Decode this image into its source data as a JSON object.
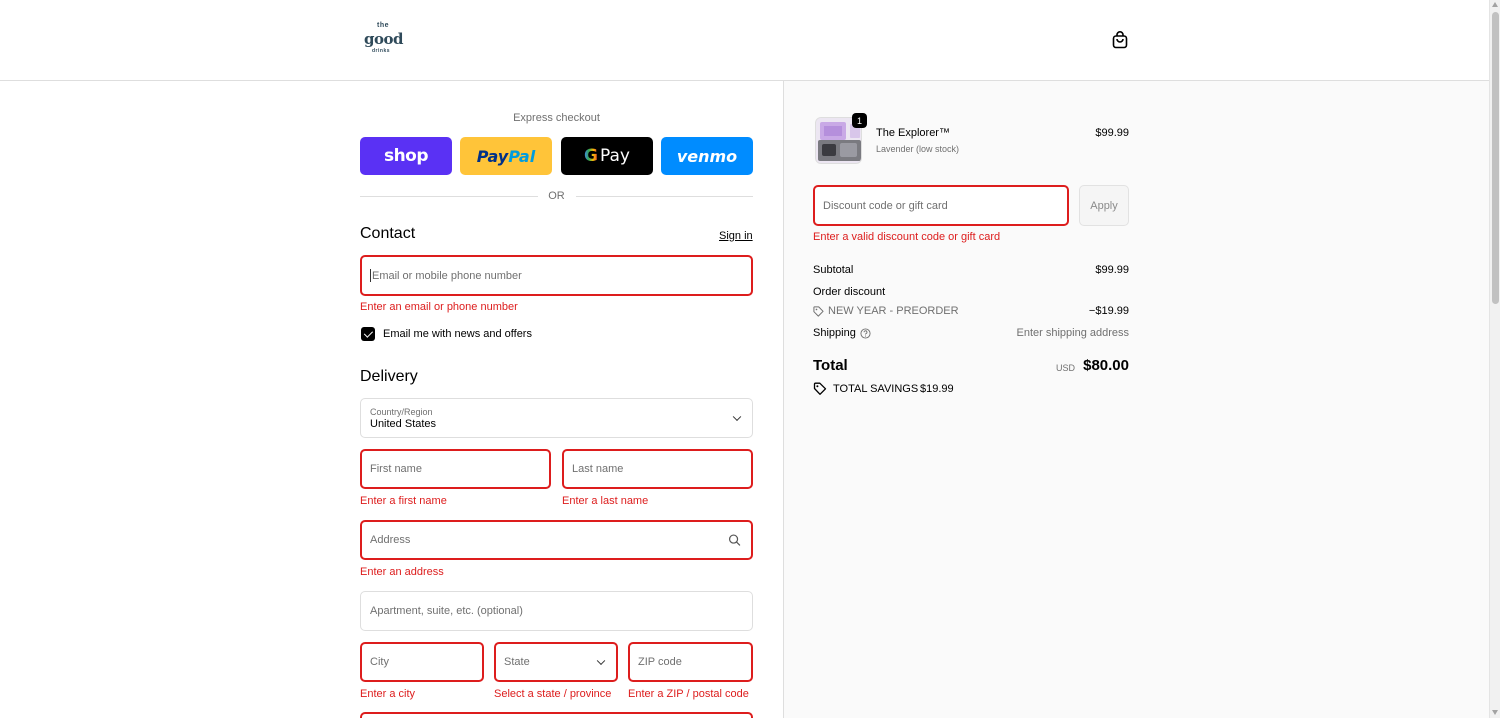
{
  "header": {
    "logo_top": "the",
    "logo_main": "good",
    "logo_bottom": "drinks"
  },
  "express": {
    "label": "Express checkout",
    "shop": "shop",
    "paypal_a": "Pay",
    "paypal_b": "Pal",
    "gpay_g": "G",
    "gpay": "Pay",
    "venmo": "venmo",
    "or": "OR"
  },
  "contact": {
    "title": "Contact",
    "sign_in": "Sign in",
    "email_placeholder": "Email or mobile phone number",
    "email_error": "Enter an email or phone number",
    "newsletter_label": "Email me with news and offers"
  },
  "delivery": {
    "title": "Delivery",
    "country_label": "Country/Region",
    "country_value": "United States",
    "first_name_placeholder": "First name",
    "first_name_error": "Enter a first name",
    "last_name_placeholder": "Last name",
    "last_name_error": "Enter a last name",
    "address_placeholder": "Address",
    "address_error": "Enter an address",
    "apartment_placeholder": "Apartment, suite, etc. (optional)",
    "city_placeholder": "City",
    "city_error": "Enter a city",
    "state_placeholder": "State",
    "state_error": "Select a state / province",
    "zip_placeholder": "ZIP code",
    "zip_error": "Enter a ZIP / postal code"
  },
  "summary": {
    "item_name": "The Explorer™",
    "item_variant": "Lavender (low stock)",
    "item_price": "$99.99",
    "item_qty": "1",
    "discount_placeholder": "Discount code or gift card",
    "apply": "Apply",
    "discount_error": "Enter a valid discount code or gift card",
    "subtotal_label": "Subtotal",
    "subtotal_value": "$99.99",
    "order_discount_label": "Order discount",
    "discount_code": "NEW YEAR - PREORDER",
    "discount_value": "−$19.99",
    "shipping_label": "Shipping",
    "shipping_value": "Enter shipping address",
    "total_label": "Total",
    "currency": "USD",
    "total_value": "$80.00",
    "savings_label": "TOTAL SAVINGS",
    "savings_value": "$19.99"
  },
  "colors": {
    "error": "#dd1d1d",
    "shop": "#5a31f4",
    "paypal": "#ffc439",
    "venmo": "#008cff"
  }
}
